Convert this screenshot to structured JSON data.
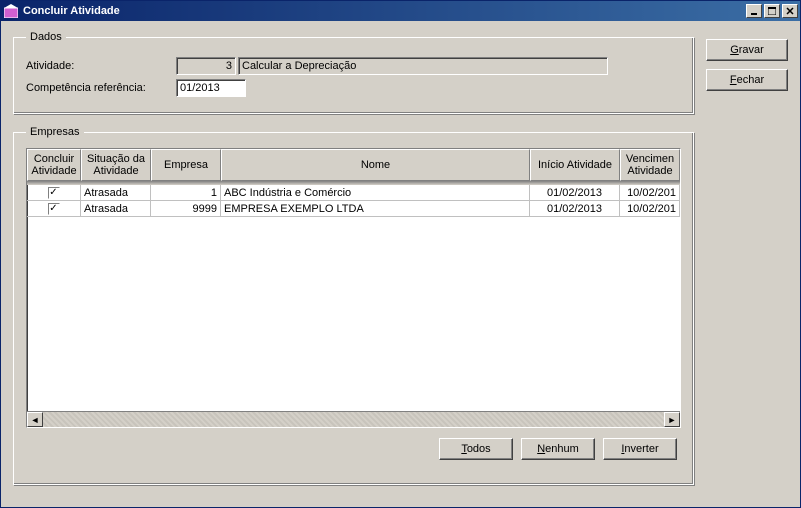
{
  "window": {
    "title": "Concluir Atividade"
  },
  "buttons": {
    "gravar_pre": "",
    "gravar_accel": "G",
    "gravar_post": "ravar",
    "fechar_pre": "",
    "fechar_accel": "F",
    "fechar_post": "echar",
    "todos_pre": "",
    "todos_accel": "T",
    "todos_post": "odos",
    "nenhum_pre": "",
    "nenhum_accel": "N",
    "nenhum_post": "enhum",
    "inverter_pre": "",
    "inverter_accel": "I",
    "inverter_post": "nverter"
  },
  "dados": {
    "legend": "Dados",
    "atividade_label": "Atividade:",
    "atividade_codigo": "3",
    "atividade_descricao": "Calcular a Depreciação",
    "competencia_label": "Competência referência:",
    "competencia_valor": "01/2013"
  },
  "empresas": {
    "legend": "Empresas",
    "headers": {
      "concluir": "Concluir\nAtividade",
      "situacao": "Situação da\nAtividade",
      "empresa": "Empresa",
      "nome": "Nome",
      "inicio": "Início Atividade",
      "vencimento": "Vencimen\nAtividade"
    },
    "rows": [
      {
        "checked": true,
        "situacao": "Atrasada",
        "empresa": "1",
        "nome": "ABC Indústria e Comércio",
        "inicio": "01/02/2013",
        "venc": "10/02/201"
      },
      {
        "checked": true,
        "situacao": "Atrasada",
        "empresa": "9999",
        "nome": "EMPRESA EXEMPLO LTDA",
        "inicio": "01/02/2013",
        "venc": "10/02/201"
      }
    ]
  }
}
